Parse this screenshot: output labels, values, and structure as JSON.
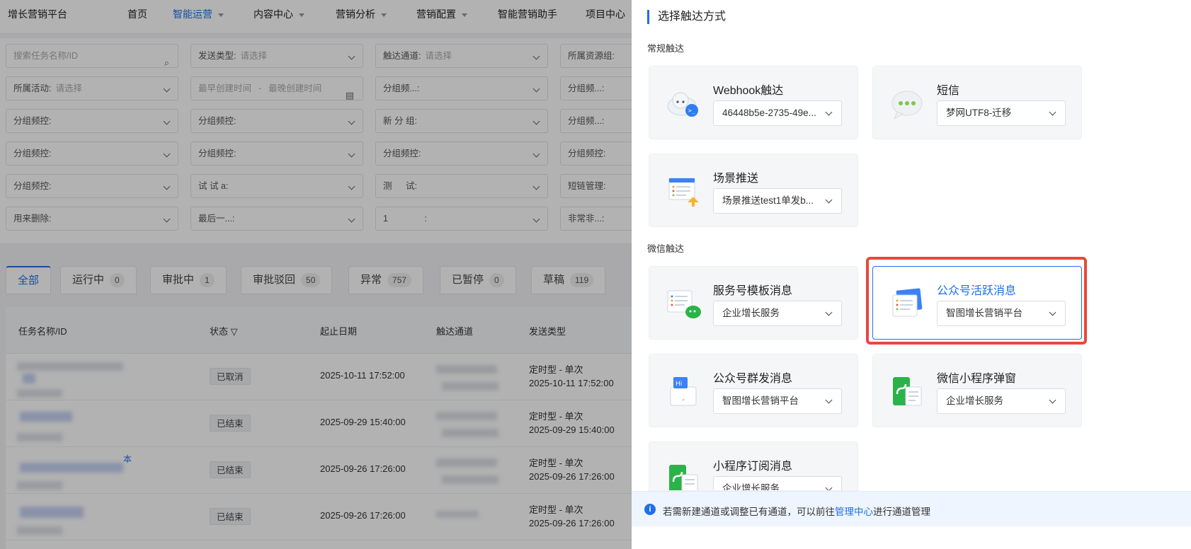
{
  "brand": "增长营销平台",
  "nav": [
    {
      "label": "首页"
    },
    {
      "label": "智能运营",
      "active": true
    },
    {
      "label": "内容中心"
    },
    {
      "label": "营销分析"
    },
    {
      "label": "营销配置"
    },
    {
      "label": "智能营销助手"
    },
    {
      "label": "项目中心"
    }
  ],
  "filters": {
    "search_placeholder": "搜索任务名称/ID",
    "send_type": "发送类型:",
    "send_type_ph": "请选择",
    "channel": "触达通道:",
    "channel_ph": "请选择",
    "resource_group": "所属资源组:",
    "activity": "所属活动:",
    "activity_ph": "请选择",
    "created_start": "最早创建时间",
    "created_sep": "-",
    "created_end": "最晚创建时间",
    "group_freq_1": "分组频...:",
    "group_freq_2": "分组频...:",
    "group_freq_3": "分组频控:",
    "group_freq_4": "分组频控:",
    "new_group": "新 分 组:",
    "group_freq_5": "分组频...:",
    "group_freq_6": "分组频控:",
    "group_freq_7": "分组频控:",
    "group_freq_8": "分组频控:",
    "group_freq_9": "分组频控:",
    "group_freq_10": "分组频控:",
    "try": "试 试 a:",
    "test": "测 　 试:",
    "shortlink": "短链管理:",
    "delete": "用来删除:",
    "last": "最后一...:",
    "one": "1 　 　 　 :",
    "very": "非常非...:"
  },
  "tabs": [
    {
      "label": "全部",
      "active": true
    },
    {
      "label": "运行中",
      "count": "0"
    },
    {
      "label": "审批中",
      "count": "1"
    },
    {
      "label": "审批驳回",
      "count": "50"
    },
    {
      "label": "异常",
      "count": "757"
    },
    {
      "label": "已暂停",
      "count": "0"
    },
    {
      "label": "草稿",
      "count": "119"
    }
  ],
  "table": {
    "headers": {
      "name": "任务名称/ID",
      "status": "状态",
      "date": "起止日期",
      "channel": "触达通道",
      "type": "发送类型"
    },
    "rows": [
      {
        "status": "已取消",
        "date": "2025-10-11 17:52:00",
        "type1": "定时型 - 单次",
        "type2": "2025-10-11 17:52:00"
      },
      {
        "status": "已结束",
        "date": "2025-09-29 15:40:00",
        "type1": "定时型 - 单次",
        "type2": "2025-09-29 15:40:00"
      },
      {
        "status": "已结束",
        "date": "2025-09-26 17:26:00",
        "type1": "定时型 - 单次",
        "type2": "2025-09-26 17:26:00",
        "name_suffix": "本"
      },
      {
        "status": "已结束",
        "date": "2025-09-26 17:26:00",
        "type1": "定时型 - 单次",
        "type2": "2025-09-26 17:26:00"
      }
    ]
  },
  "panel": {
    "title": "选择触达方式",
    "section_regular": "常规触达",
    "section_wechat": "微信触达",
    "cards": {
      "webhook": {
        "name": "Webhook触达",
        "value": "46448b5e-2735-49e..."
      },
      "sms": {
        "name": "短信",
        "value": "梦网UTF8-迁移"
      },
      "scene": {
        "name": "场景推送",
        "value": "场景推送test1单发b..."
      },
      "service_tpl": {
        "name": "服务号模板消息",
        "value": "企业增长服务"
      },
      "oa_active": {
        "name": "公众号活跃消息",
        "value": "智图增长营销平台"
      },
      "oa_mass": {
        "name": "公众号群发消息",
        "value": "智图增长营销平台"
      },
      "mini_popup": {
        "name": "微信小程序弹窗",
        "value": "企业增长服务"
      },
      "mini_sub": {
        "name": "小程序订阅消息",
        "value": "企业增长服务"
      }
    },
    "notice": {
      "before": "若需新建通道或调整已有通道，可以前往",
      "link": "管理中心",
      "after": "进行通道管理"
    }
  },
  "colors": {
    "accent": "#1f6fe8",
    "highlight": "#e8483f"
  }
}
